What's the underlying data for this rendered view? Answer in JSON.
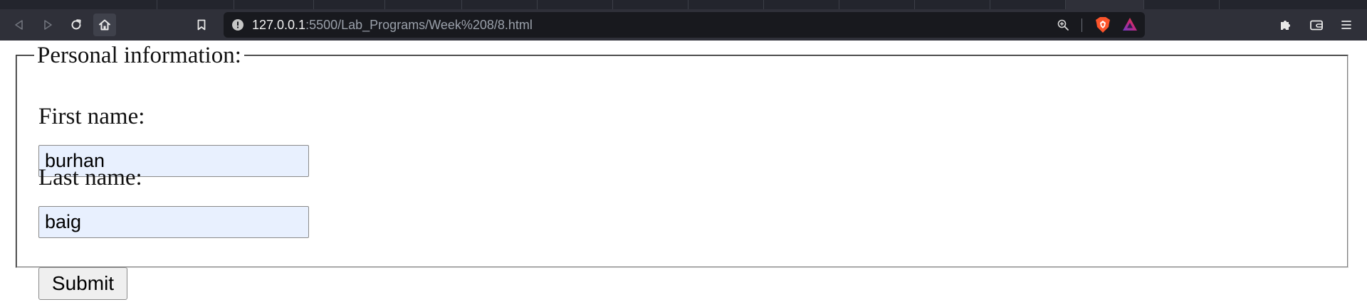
{
  "browser": {
    "url_host": "127.0.0.1",
    "url_path": ":5500/Lab_Programs/Week%208/8.html",
    "icons": {
      "back": "back-triangle-icon",
      "forward": "forward-triangle-icon",
      "reload": "reload-icon",
      "home": "home-icon",
      "bookmark": "bookmark-icon",
      "site_info": "info-icon",
      "zoom": "zoom-icon",
      "shields": "brave-shield-icon",
      "rewards": "brave-rewards-icon",
      "extensions": "puzzle-icon",
      "wallet": "wallet-icon",
      "menu": "hamburger-icon"
    },
    "colors": {
      "tabstrip": "#23252d",
      "toolbar": "#2f3039",
      "urlbar": "#18191e",
      "brave_orange": "#fb542b"
    }
  },
  "form": {
    "legend": "Personal information:",
    "first_name_label": "First name:",
    "first_name_value": "burhan",
    "last_name_label": "Last name:",
    "last_name_value": "baig",
    "submit_label": "Submit",
    "autofill_color": "#e8f0fe"
  }
}
